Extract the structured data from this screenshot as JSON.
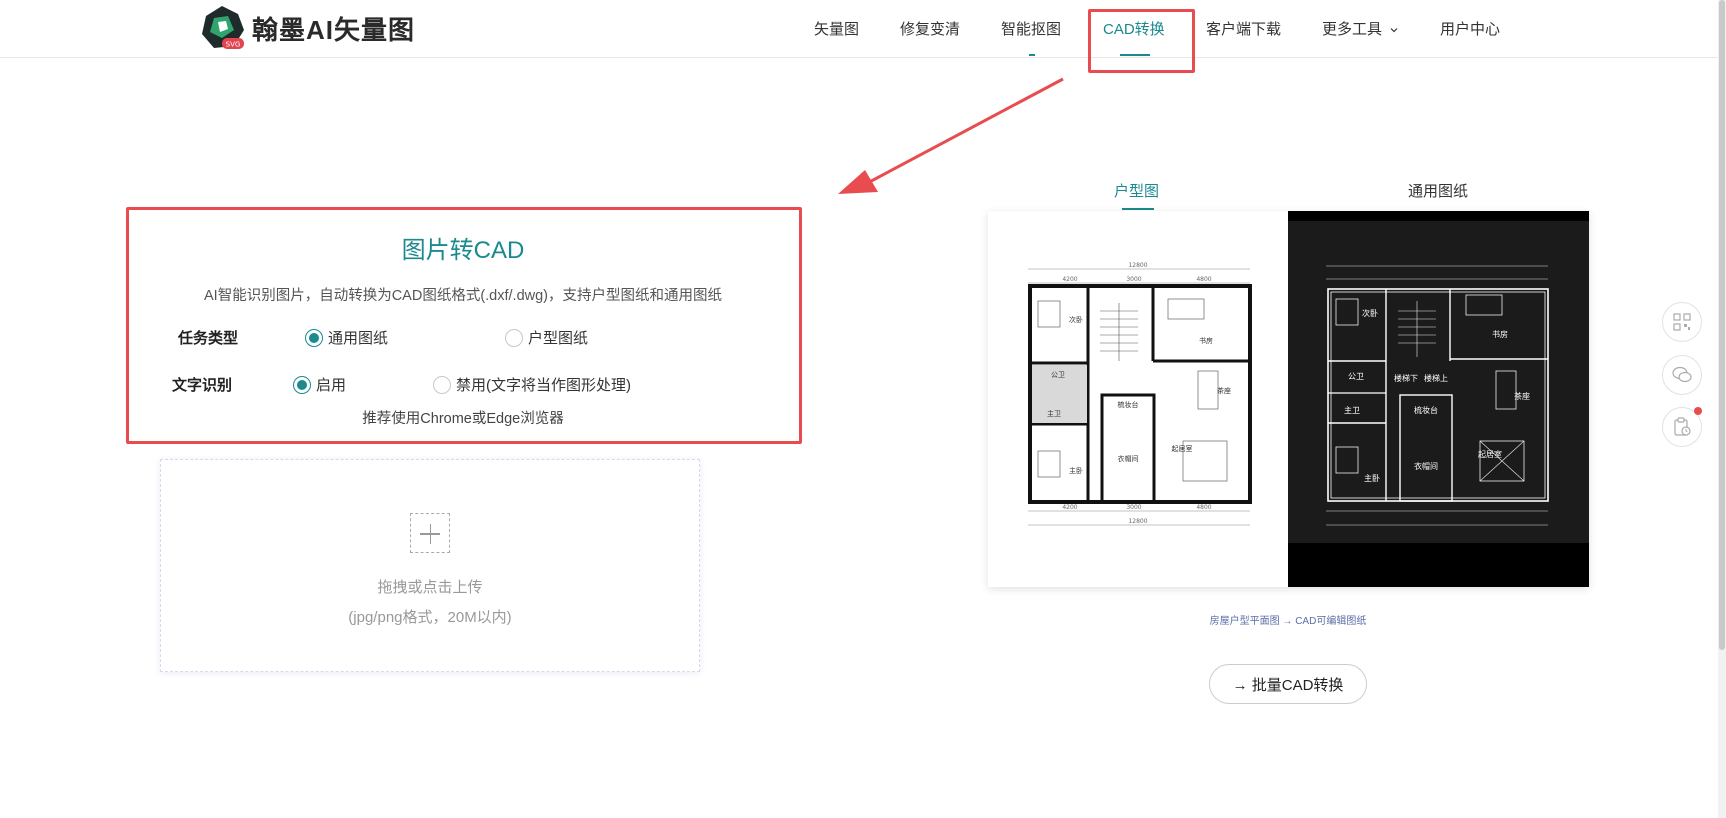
{
  "header": {
    "logo_text": "翰墨AI矢量图",
    "logo_badge": "SVG",
    "nav": [
      {
        "label": "矢量图"
      },
      {
        "label": "修复变清"
      },
      {
        "label": "智能抠图"
      },
      {
        "label": "CAD转换"
      },
      {
        "label": "客户端下载"
      },
      {
        "label": "更多工具"
      },
      {
        "label": "用户中心"
      }
    ],
    "active_nav": "CAD转换"
  },
  "main": {
    "title": "图片转CAD",
    "description": "AI智能识别图片，自动转换为CAD图纸格式(.dxf/.dwg)，支持户型图纸和通用图纸",
    "task_type": {
      "label": "任务类型",
      "options": [
        "通用图纸",
        "户型图纸"
      ],
      "selected": "通用图纸"
    },
    "text_recognition": {
      "label": "文字识别",
      "options": [
        "启用",
        "禁用(文字将当作图形处理)"
      ],
      "selected": "启用"
    },
    "hint": "推荐使用Chrome或Edge浏览器",
    "upload": {
      "line1": "拖拽或点击上传",
      "line2": "(jpg/png格式，20M以内)"
    }
  },
  "preview": {
    "tabs": [
      "户型图",
      "通用图纸"
    ],
    "active_tab": "户型图",
    "caption": "房屋户型平面图 → CAD可编辑图纸",
    "batch_button": "→ 批量CAD转换",
    "plan_rooms": [
      "次卧",
      "书房",
      "公卫",
      "主卫",
      "主卧",
      "衣帽间",
      "梳妆台",
      "茶座",
      "起居室"
    ],
    "plan_rooms_dark": [
      "次卧",
      "书房",
      "公卫",
      "主卫",
      "主卧",
      "衣帽间",
      "梳妆台",
      "茶座",
      "起居室",
      "楼梯下",
      "楼梯上"
    ],
    "dims_top": [
      "12800",
      "4200",
      "3000",
      "4800"
    ],
    "dims_bottom": [
      "4200",
      "3000",
      "4800",
      "12800"
    ]
  },
  "colors": {
    "accent": "#1a8a8f",
    "annotation": "#e84c4f"
  },
  "side_icons": [
    "qrcode-icon",
    "wechat-icon",
    "clipboard-icon"
  ]
}
